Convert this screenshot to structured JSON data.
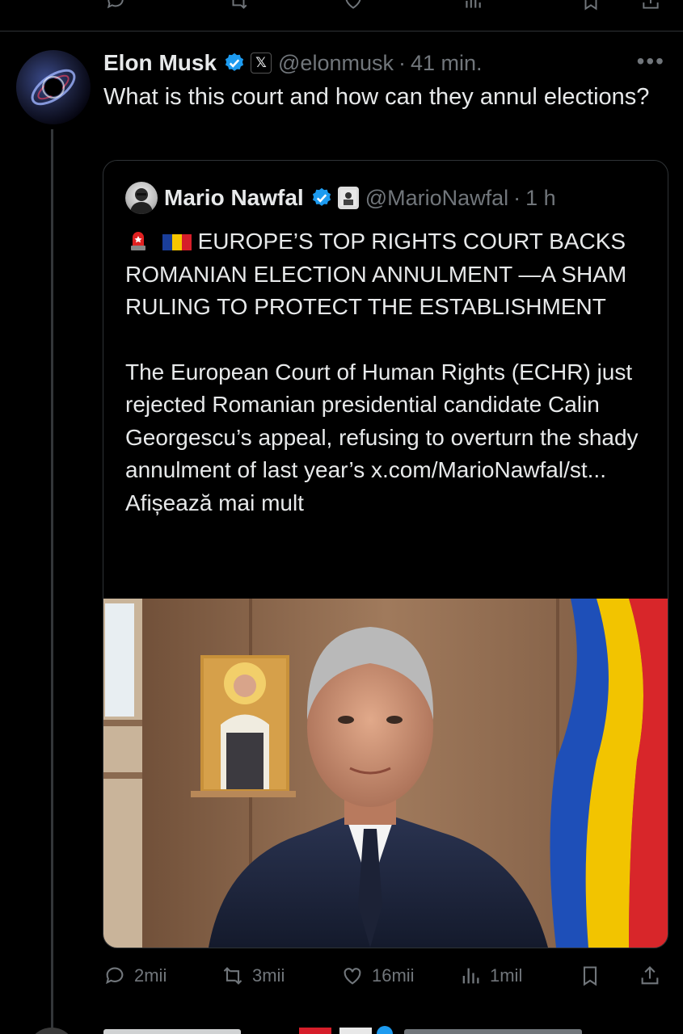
{
  "post": {
    "author_name": "Elon Musk",
    "handle": "@elonmusk",
    "separator": "·",
    "time": "41 min.",
    "more_label": "•••",
    "text": "What is this court and how can they annul elections?"
  },
  "quoted": {
    "author_name": "Mario Nawfal",
    "handle": "@MarioNawfal",
    "separator": "·",
    "time": "1 h",
    "headline": "EUROPE’S TOP RIGHTS COURT BACKS ROMANIAN ELECTION ANNULMENT —A SHAM RULING TO PROTECT THE ESTABLISHMENT",
    "body": "The European Court of Human Rights (ECHR) just rejected Romanian presidential candidate Calin Georgescu’s appeal, refusing to overturn the shady annulment of last year’s x.com/MarioNawfal/st...",
    "show_more": "Afișează mai mult",
    "image_alt": "Man in suit in front of icon painting and Romanian flag"
  },
  "actions": {
    "replies": "2mii",
    "reposts": "3mii",
    "likes": "16mii",
    "views": "1mil"
  },
  "colors": {
    "background": "#000000",
    "text": "#e7e9ea",
    "muted": "#71767b",
    "border": "#2f3336",
    "verified": "#1d9bf0"
  }
}
